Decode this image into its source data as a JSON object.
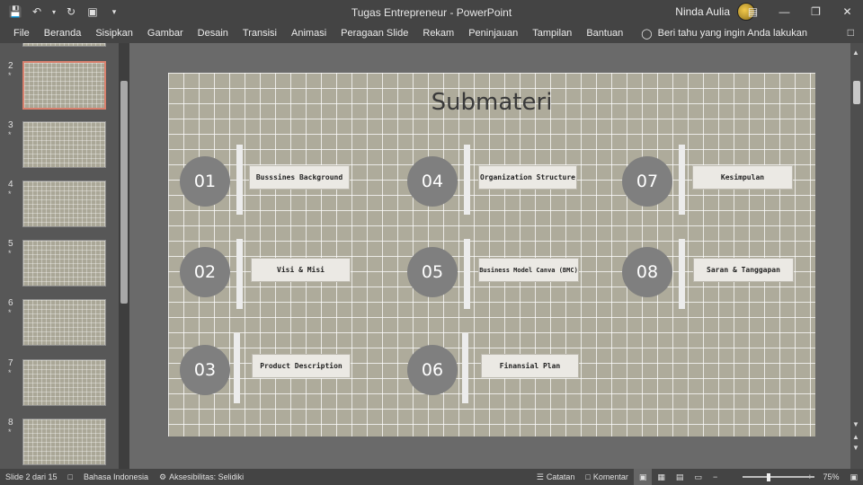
{
  "app": {
    "title": "Tugas Entrepreneur",
    "separator": "-",
    "app_name": "PowerPoint",
    "user_name": "Ninda Aulia"
  },
  "menu": [
    "File",
    "Beranda",
    "Sisipkan",
    "Gambar",
    "Desain",
    "Transisi",
    "Animasi",
    "Peragaan Slide",
    "Rekam",
    "Peninjauan",
    "Tampilan",
    "Bantuan"
  ],
  "tell_me": "Beri tahu yang ingin Anda lakukan",
  "thumbnails": [
    {
      "num": "2",
      "star": "*",
      "selected": true
    },
    {
      "num": "3",
      "star": "*"
    },
    {
      "num": "4",
      "star": "*"
    },
    {
      "num": "5",
      "star": "*"
    },
    {
      "num": "6",
      "star": "*"
    },
    {
      "num": "7",
      "star": "*"
    },
    {
      "num": "8",
      "star": "*"
    }
  ],
  "slide": {
    "title": "Submateri",
    "items": [
      {
        "num": "01",
        "label": "Busssines Background"
      },
      {
        "num": "02",
        "label": "Visi & Misi"
      },
      {
        "num": "03",
        "label": "Product Description"
      },
      {
        "num": "04",
        "label": "Organization Structure"
      },
      {
        "num": "05",
        "label": "Business Model Canva (BMC)"
      },
      {
        "num": "06",
        "label": "Finansial Plan"
      },
      {
        "num": "07",
        "label": "Kesimpulan"
      },
      {
        "num": "08",
        "label": "Saran & Tanggapan"
      }
    ]
  },
  "status": {
    "slide_info": "Slide 2 dari 15",
    "language": "Bahasa Indonesia",
    "accessibility": "Aksesibilitas: Selidiki",
    "notes": "Catatan",
    "comments": "Komentar",
    "zoom_minus": "−",
    "zoom_plus": "+",
    "zoom": "75%"
  }
}
